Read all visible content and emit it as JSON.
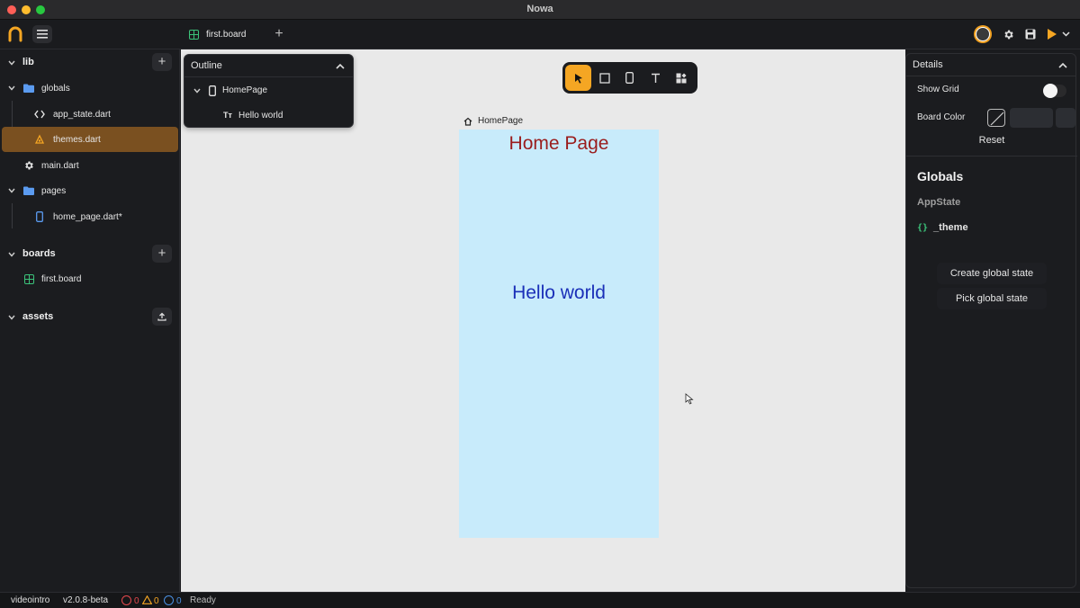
{
  "window": {
    "title": "Nowa"
  },
  "topbar": {
    "logo_icon": "nowa-logo-icon",
    "menu_icon": "hamburger-icon",
    "tab": {
      "label": "first.board",
      "icon": "board-grid-icon"
    },
    "add_tab_label": "+",
    "actions": [
      "user-avatar",
      "gear-icon",
      "save-icon",
      "play-icon",
      "chevron-down-icon"
    ]
  },
  "sidebar": {
    "sections": {
      "lib": {
        "label": "lib",
        "add_label": "+"
      },
      "boards": {
        "label": "boards",
        "add_label": "+"
      },
      "assets": {
        "label": "assets",
        "upload_icon": "upload-icon"
      }
    },
    "lib_items": [
      {
        "label": "globals",
        "icon": "folder-icon"
      },
      {
        "label": "app_state.dart",
        "icon": "code-icon"
      },
      {
        "label": "themes.dart",
        "icon": "palette-icon",
        "selected": true
      },
      {
        "label": "main.dart",
        "icon": "gear-icon"
      },
      {
        "label": "pages",
        "icon": "folder-icon"
      },
      {
        "label": "home_page.dart*",
        "icon": "phone-icon"
      }
    ],
    "board_items": [
      {
        "label": "first.board",
        "icon": "board-grid-icon"
      }
    ]
  },
  "outline": {
    "title": "Outline",
    "items": [
      {
        "label": "HomePage",
        "icon": "phone-icon"
      },
      {
        "label": "Hello world",
        "icon": "text-icon"
      }
    ]
  },
  "toolbar": {
    "tools": [
      "pointer-icon",
      "rectangle-icon",
      "phone-icon",
      "text-tool-icon",
      "widgets-icon"
    ],
    "active_tool": "pointer-icon"
  },
  "canvas": {
    "frame_label": "HomePage",
    "home_title": "Home Page",
    "hello_text": "Hello world",
    "frame_bg": "#c8ebfb"
  },
  "details": {
    "title": "Details",
    "show_grid_label": "Show Grid",
    "show_grid_on": false,
    "board_color_label": "Board Color",
    "reset_label": "Reset",
    "globals_title": "Globals",
    "appstate_label": "AppState",
    "theme_var": "_theme",
    "create_global_label": "Create global state",
    "pick_global_label": "Pick global state"
  },
  "statusbar": {
    "project": "videointro",
    "version": "v2.0.8-beta",
    "errors": "0",
    "warnings": "0",
    "infos": "0",
    "status": "Ready"
  },
  "colors": {
    "accent": "#f5a623",
    "selected_row": "#7a5020",
    "error": "#e5484d",
    "warning": "#f5a623",
    "info": "#4a90e2",
    "home_title": "#9a1d1d",
    "hello_text": "#1a2fb8"
  }
}
